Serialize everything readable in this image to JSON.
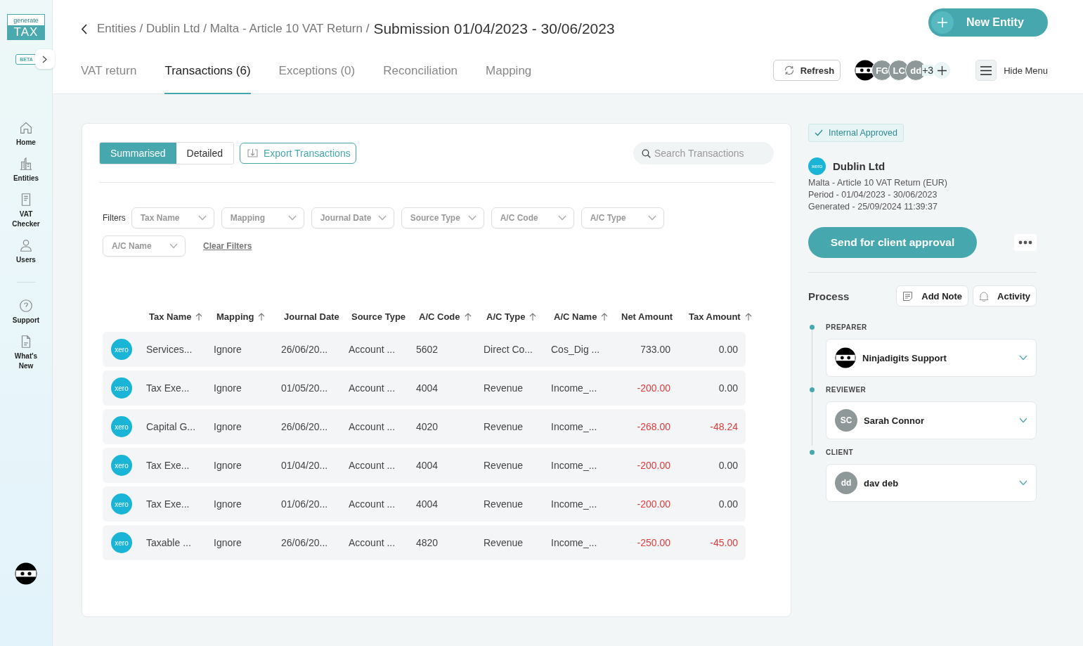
{
  "logo": {
    "top": "generate",
    "bottom": "TAX",
    "badge": "BETA"
  },
  "sidebar": {
    "items": [
      {
        "label": "Home"
      },
      {
        "label": "Entities"
      },
      {
        "label": "VAT Checker"
      },
      {
        "label": "Users"
      },
      {
        "label": "Support"
      },
      {
        "label": "What's New"
      }
    ]
  },
  "header": {
    "breadcrumb_trail": "Entities / Dublin Ltd / Malta - Article 10 VAT Return /",
    "breadcrumb_current": "Submission 01/04/2023 - 30/06/2023",
    "new_button": "New Entity",
    "tabs": [
      {
        "label": "VAT return",
        "selected": false
      },
      {
        "label": "Transactions (6)",
        "selected": true
      },
      {
        "label": "Exceptions (0)",
        "selected": false
      },
      {
        "label": "Reconciliation",
        "selected": false
      },
      {
        "label": "Mapping",
        "selected": false
      }
    ],
    "refresh_button": "Refresh",
    "avatars": [
      {
        "kind": "ninja"
      },
      {
        "kind": "initials",
        "text": "FG"
      },
      {
        "kind": "initials",
        "text": "LC"
      },
      {
        "kind": "initials",
        "text": "dd"
      },
      {
        "kind": "more",
        "text": "+3"
      }
    ],
    "menu_button": "Hide Menu"
  },
  "transactions": {
    "view_toggle": [
      {
        "label": "Summarised",
        "selected": true
      },
      {
        "label": "Detailed",
        "selected": false
      }
    ],
    "export_button": "Export Transactions",
    "search": {
      "placeholder": "Search Transactions"
    },
    "filters_label": "Filters",
    "filters": [
      "Tax Name",
      "Mapping",
      "Journal Date",
      "Source Type",
      "A/C Code",
      "A/C Type",
      "A/C Name"
    ],
    "clear_filters": "Clear Filters",
    "table": {
      "columns": [
        {
          "label": "Tax Name",
          "sortable": true
        },
        {
          "label": "Mapping",
          "sortable": true
        },
        {
          "label": "Journal Date",
          "sortable": false
        },
        {
          "label": "Source Type",
          "sortable": false
        },
        {
          "label": "A/C Code",
          "sortable": true
        },
        {
          "label": "A/C Type",
          "sortable": true
        },
        {
          "label": "A/C Name",
          "sortable": true
        },
        {
          "label": "Net Amount",
          "sortable": false
        },
        {
          "label": "Tax Amount",
          "sortable": true
        }
      ],
      "rows": [
        {
          "logo": "xero",
          "cells": [
            "Services...",
            "Ignore",
            "26/06/20...",
            "Account ...",
            "5602",
            "Direct Co...",
            "Cos_Dig ...",
            "733.00",
            "0.00"
          ],
          "net_negative": false,
          "tax_negative": false
        },
        {
          "logo": "xero",
          "cells": [
            "Tax Exe...",
            "Ignore",
            "01/05/20...",
            "Account ...",
            "4004",
            "Revenue",
            "Income_...",
            "-200.00",
            "0.00"
          ],
          "net_negative": true,
          "tax_negative": false
        },
        {
          "logo": "xero",
          "cells": [
            "Capital G...",
            "Ignore",
            "26/06/20...",
            "Account ...",
            "4020",
            "Revenue",
            "Income_...",
            "-268.00",
            "-48.24"
          ],
          "net_negative": true,
          "tax_negative": true
        },
        {
          "logo": "xero",
          "cells": [
            "Tax Exe...",
            "Ignore",
            "01/04/20...",
            "Account ...",
            "4004",
            "Revenue",
            "Income_...",
            "-200.00",
            "0.00"
          ],
          "net_negative": true,
          "tax_negative": false
        },
        {
          "logo": "xero",
          "cells": [
            "Tax Exe...",
            "Ignore",
            "01/06/20...",
            "Account ...",
            "4004",
            "Revenue",
            "Income_...",
            "-200.00",
            "0.00"
          ],
          "net_negative": true,
          "tax_negative": false
        },
        {
          "logo": "xero",
          "cells": [
            "Taxable ...",
            "Ignore",
            "26/06/20...",
            "Account ...",
            "4820",
            "Revenue",
            "Income_...",
            "-250.00",
            "-45.00"
          ],
          "net_negative": true,
          "tax_negative": true
        }
      ]
    }
  },
  "details": {
    "status_badge": "Internal Approved",
    "entity_logo": "xero",
    "entity_name": "Dublin Ltd",
    "info_lines": [
      "Malta - Article 10 VAT Return (EUR)",
      "Period - 01/04/2023 - 30/06/2023",
      "Generated - 25/09/2024 11:39:37"
    ],
    "send_button": "Send for client approval",
    "process_title": "Process",
    "add_note_button": "Add Note",
    "activity_button": "Activity",
    "steps": [
      {
        "label": "PREPARER",
        "kind": "ninja",
        "name": "Ninjadigits Support"
      },
      {
        "label": "REVIEWER",
        "kind": "initials",
        "initials": "SC",
        "name": "Sarah Connor"
      },
      {
        "label": "CLIENT",
        "kind": "initials",
        "initials": "dd",
        "name": "dav deb"
      }
    ]
  }
}
